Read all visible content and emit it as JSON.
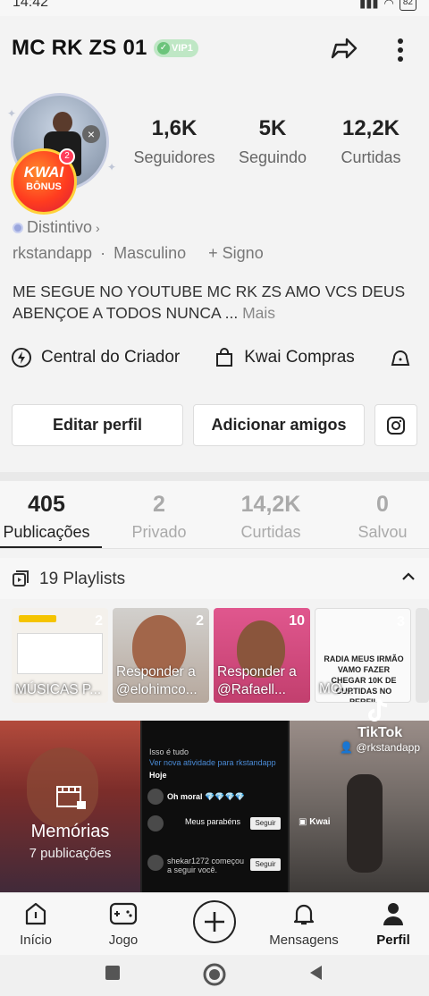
{
  "status": {
    "time": "14:42",
    "battery": "82"
  },
  "profile": {
    "username": "MC RK ZS 01",
    "vip_label": "VIP1",
    "kwai_bonus_line1": "KWAI",
    "kwai_bonus_line2": "BÔNUS",
    "kwai_bonus_count": "2",
    "distintivo": "Distintivo",
    "handle": "rkstandapp",
    "gender": "Masculino",
    "sign": "+ Signo",
    "bio": "ME SEGUE NO YOUTUBE MC RK ZS AMO VCS DEUS ABENÇOE A TODOS NUNCA ...",
    "bio_more": "Mais"
  },
  "stats": [
    {
      "value": "1,6K",
      "label": "Seguidores"
    },
    {
      "value": "5K",
      "label": "Seguindo"
    },
    {
      "value": "12,2K",
      "label": "Curtidas"
    }
  ],
  "links": [
    {
      "label": "Central do Criador",
      "icon": "bolt-icon"
    },
    {
      "label": "Kwai Compras",
      "icon": "shopping-bag-icon"
    },
    {
      "label": "",
      "icon": "bell-icon"
    }
  ],
  "buttons": {
    "edit": "Editar perfil",
    "add_friends": "Adicionar amigos"
  },
  "tabs": [
    {
      "count": "405",
      "label": "Publicações",
      "active": true
    },
    {
      "count": "2",
      "label": "Privado"
    },
    {
      "count": "14,2K",
      "label": "Curtidas"
    },
    {
      "count": "0",
      "label": "Salvou"
    }
  ],
  "playlists": {
    "title": "19 Playlists",
    "items": [
      {
        "count": "2",
        "caption": "MÚSICAS P...",
        "card_text": ""
      },
      {
        "count": "2",
        "caption": "Responder a @elohimco...",
        "card_text": ""
      },
      {
        "count": "10",
        "caption": "Responder a @Rafaell...",
        "card_text": ""
      },
      {
        "count": "3",
        "caption": "MO...",
        "card_text": "RADIA MEUS IRMÃO VAMO FAZER CHEGAR 10K DE CURTIDAS NO PERFIL"
      }
    ]
  },
  "grid": {
    "memorias_title": "Memórias",
    "memorias_sub": "7 publicações",
    "notif_today": "Hoje",
    "notif_isso": "Isso é tudo",
    "notif_ver": "Ver nova atividade para rkstandapp",
    "notif_parabens": "Meus parabéns",
    "notif_seguir": "Seguir",
    "notif_shekar": "shekar1272 começou a seguir você.",
    "tiktok_brand": "TikTok",
    "tiktok_handle": "@rkstandapp"
  },
  "nav": [
    {
      "label": "Início",
      "icon": "home-icon"
    },
    {
      "label": "Jogo",
      "icon": "gamepad-icon"
    },
    {
      "label": "",
      "icon": "plus-icon"
    },
    {
      "label": "Mensagens",
      "icon": "bell-icon"
    },
    {
      "label": "Perfil",
      "icon": "person-icon",
      "active": true
    }
  ]
}
